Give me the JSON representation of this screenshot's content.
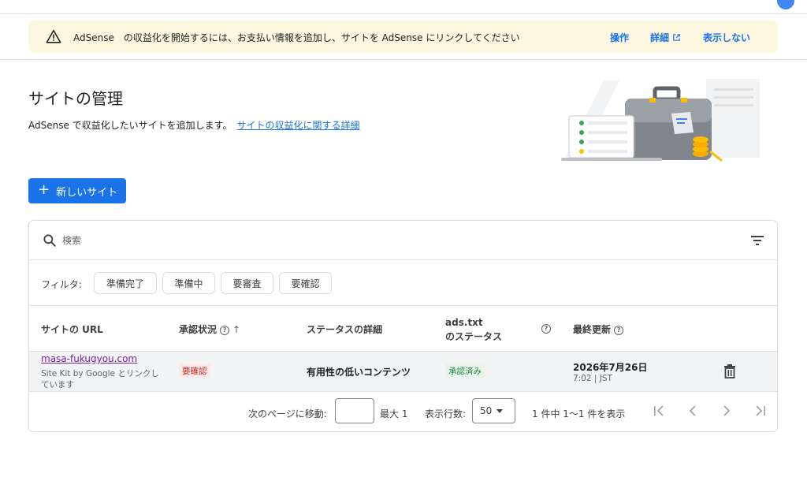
{
  "banner": {
    "message": "AdSense　の収益化を開始するには、お支払い情報を追加し、サイトを AdSense にリンクしてください",
    "action_label": "操作",
    "details_label": "詳細",
    "hide_label": "表示しない"
  },
  "page": {
    "title": "サイトの管理",
    "description": "AdSense で収益化したいサイトを追加します。",
    "learn_more_link": "サイトの収益化に関する詳細"
  },
  "new_site_button": {
    "label": "新しいサイト"
  },
  "search": {
    "placeholder": "検索",
    "value": ""
  },
  "filters": {
    "label": "フィルタ:",
    "chips": [
      "準備完了",
      "準備中",
      "要審査",
      "要確認"
    ]
  },
  "table": {
    "columns": {
      "url": "サイトの URL",
      "approval": "承認状況",
      "status_detail": "ステータスの詳細",
      "ads_txt_line1": "ads.txt",
      "ads_txt_line2": "のステータス",
      "last_updated": "最終更新"
    },
    "rows": [
      {
        "url": "masa-fukugyou.com",
        "sub_text": "Site Kit by Google とリンクしています",
        "approval_status": "要確認",
        "status_detail": "有用性の低いコンテンツ",
        "ads_txt_status": "承認済み",
        "updated_date": "2026年7月26日",
        "updated_time": "7:02 | JST"
      }
    ]
  },
  "pagination": {
    "goto_label": "次のページに移動:",
    "goto_value": "",
    "max_label": "最大 1",
    "rows_label": "表示行数:",
    "rows_value": "50",
    "range_label": "1 件中 1〜1 件を表示"
  },
  "colors": {
    "accent": "#1a73e8",
    "banner_bg": "#fef7e0",
    "warning_badge": "#c5221f",
    "success_badge": "#188038"
  },
  "icons": {
    "warning": "warning-icon",
    "external": "external-link-icon",
    "search": "search-icon",
    "filter": "filter-list-icon",
    "help": "help-icon",
    "sort": "arrow-up-icon",
    "delete": "trash-icon",
    "first": "first-page-icon",
    "prev": "chevron-left-icon",
    "next": "chevron-right-icon",
    "last": "last-page-icon"
  }
}
